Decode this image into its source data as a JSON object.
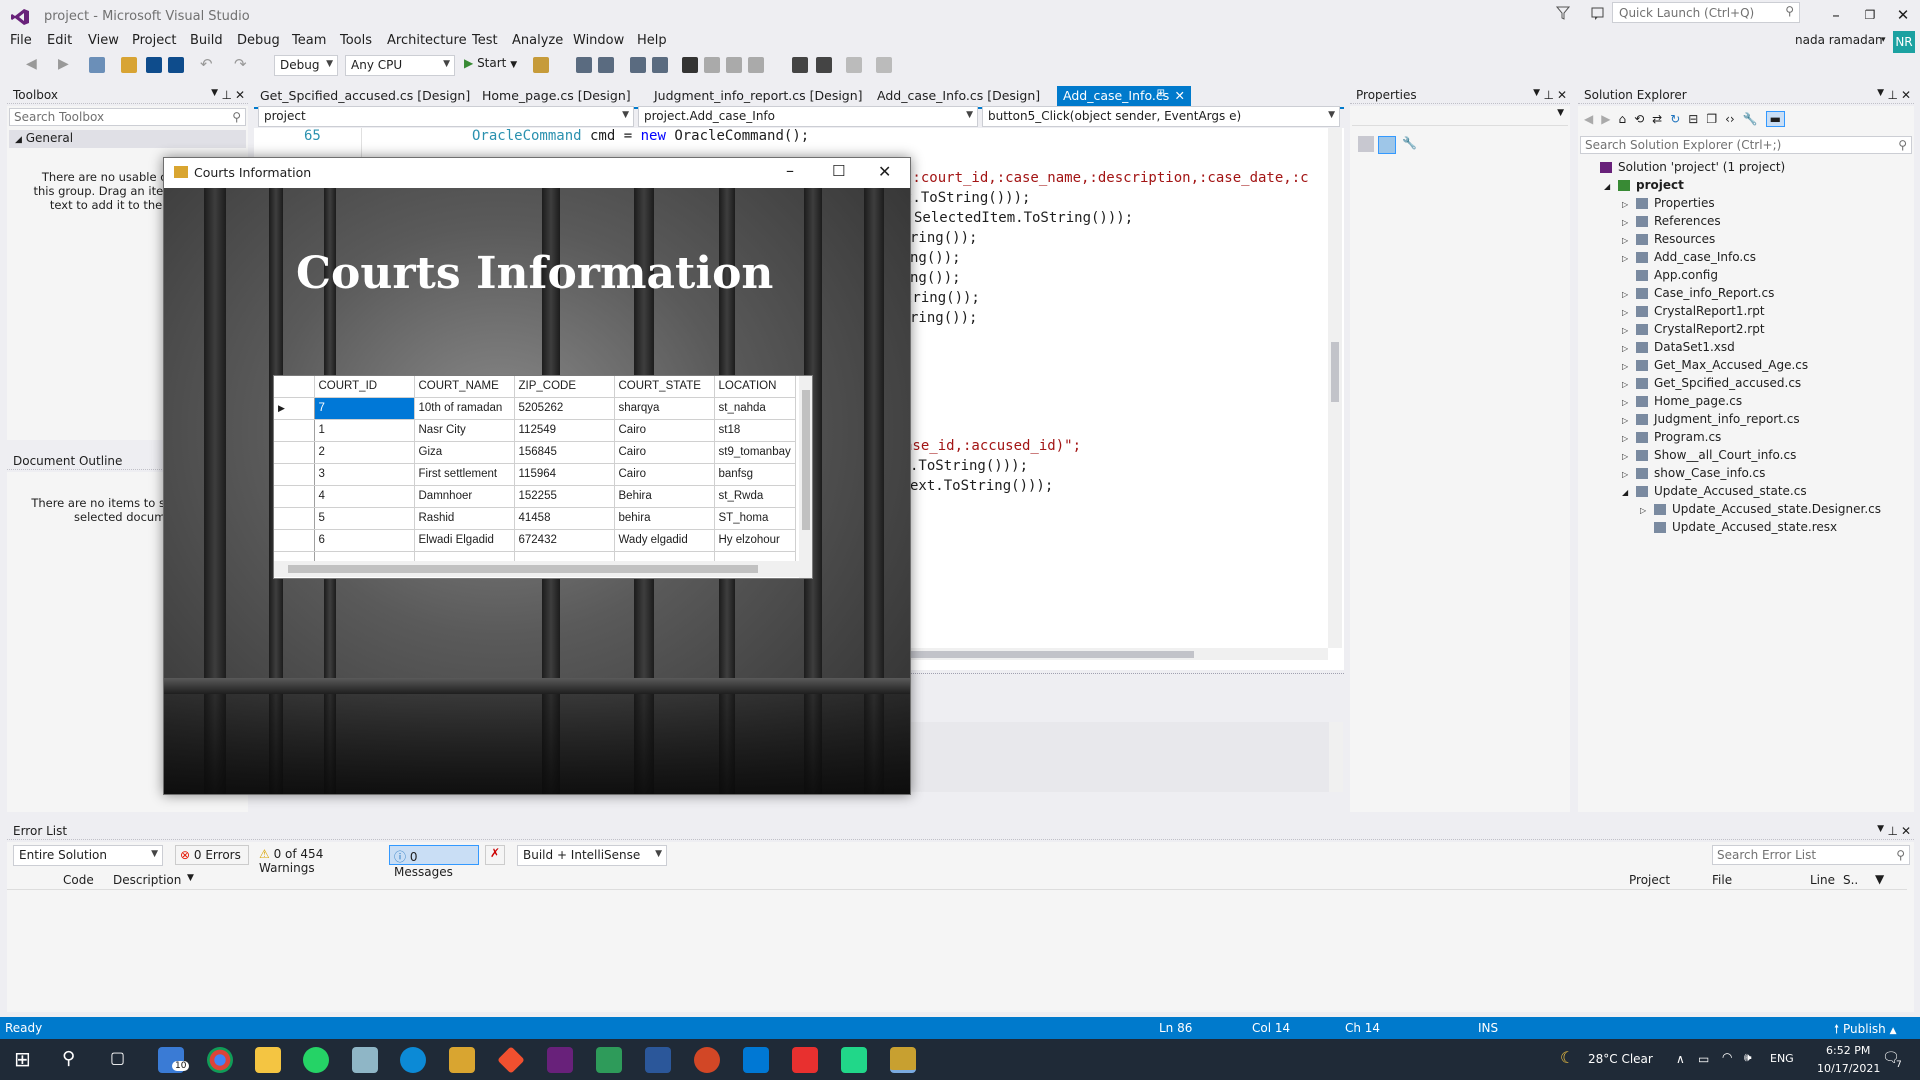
{
  "window": {
    "title": "project - Microsoft Visual Studio",
    "quick_launch": "Quick Launch (Ctrl+Q)",
    "user": "nada ramadan",
    "avatar": "NR"
  },
  "menu": [
    "File",
    "Edit",
    "View",
    "Project",
    "Build",
    "Debug",
    "Team",
    "Tools",
    "Architecture",
    "Test",
    "Analyze",
    "Window",
    "Help"
  ],
  "toolbar": {
    "config": "Debug",
    "platform": "Any CPU",
    "start": "Start"
  },
  "toolbox": {
    "title": "Toolbox",
    "search": "Search Toolbox",
    "group": "General",
    "empty": "There are no usable controls in this group. Drag an item onto this text to add it to the toolbox."
  },
  "doc_outline": {
    "title": "Document Outline",
    "empty": "There are no items to show for the selected document."
  },
  "tabs": [
    "Get_Spcified_accused.cs [Design]",
    "Home_page.cs [Design]",
    "Judgment_info_report.cs [Design]",
    "Add_case_Info.cs [Design]",
    "Add_case_Info.cs"
  ],
  "nav": {
    "project": "project",
    "class": "project.Add_case_Info",
    "member": "button5_Click(object sender, EventArgs e)"
  },
  "code": {
    "line_no": "65",
    "line65_kw": "OracleCommand",
    "line65_a": " cmd = ",
    "line65_new": "new",
    "line65_b": " OracleCommand();",
    "l1": ",:court_id,:case_name,:description,:case_date,:c",
    "l2": "t.ToString()));",
    "l3": "SelectedItem.ToString()));",
    "l4": "ring());",
    "l5": "ng());",
    "l6": "ng());",
    "l7": "tring());",
    "l8": "ring());",
    "l9": "ase_id,:accused_id)\";",
    "l10": ".ToString()));",
    "l11": "ext.ToString()));"
  },
  "app": {
    "title": "Courts Information",
    "heading": "Courts Information",
    "columns": [
      "COURT_ID",
      "COURT_NAME",
      "ZIP_CODE",
      "COURT_STATE",
      "LOCATION"
    ],
    "rows": [
      [
        "7",
        "10th of ramadan",
        "5205262",
        "sharqya",
        "st_nahda"
      ],
      [
        "1",
        "Nasr City",
        "112549",
        "Cairo",
        "st18"
      ],
      [
        "2",
        "Giza",
        "156845",
        "Cairo",
        "st9_tomanbay"
      ],
      [
        "3",
        "First settlement",
        "115964",
        "Cairo",
        "banfsg"
      ],
      [
        "4",
        "Damnhoer",
        "152255",
        "Behira",
        "st_Rwda"
      ],
      [
        "5",
        "Rashid",
        "41458",
        "behira",
        "ST_homa"
      ],
      [
        "6",
        "Elwadi Elgadid",
        "672432",
        "Wady elgadid",
        "Hy elzohour"
      ]
    ]
  },
  "properties": {
    "title": "Properties"
  },
  "solution": {
    "title": "Solution Explorer",
    "search": "Search Solution Explorer (Ctrl+;)",
    "items": [
      {
        "label": "Solution 'project' (1 project)",
        "depth": 0,
        "exp": ""
      },
      {
        "label": "project",
        "depth": 1,
        "exp": "◢",
        "bold": true
      },
      {
        "label": "Properties",
        "depth": 2,
        "exp": "▷"
      },
      {
        "label": "References",
        "depth": 2,
        "exp": "▷"
      },
      {
        "label": "Resources",
        "depth": 2,
        "exp": "▷"
      },
      {
        "label": "Add_case_Info.cs",
        "depth": 2,
        "exp": "▷"
      },
      {
        "label": "App.config",
        "depth": 2,
        "exp": ""
      },
      {
        "label": "Case_info_Report.cs",
        "depth": 2,
        "exp": "▷"
      },
      {
        "label": "CrystalReport1.rpt",
        "depth": 2,
        "exp": "▷"
      },
      {
        "label": "CrystalReport2.rpt",
        "depth": 2,
        "exp": "▷"
      },
      {
        "label": "DataSet1.xsd",
        "depth": 2,
        "exp": "▷"
      },
      {
        "label": "Get_Max_Accused_Age.cs",
        "depth": 2,
        "exp": "▷"
      },
      {
        "label": "Get_Spcified_accused.cs",
        "depth": 2,
        "exp": "▷"
      },
      {
        "label": "Home_page.cs",
        "depth": 2,
        "exp": "▷"
      },
      {
        "label": "Judgment_info_report.cs",
        "depth": 2,
        "exp": "▷"
      },
      {
        "label": "Program.cs",
        "depth": 2,
        "exp": "▷"
      },
      {
        "label": "Show__all_Court_info.cs",
        "depth": 2,
        "exp": "▷"
      },
      {
        "label": "show_Case_info.cs",
        "depth": 2,
        "exp": "▷"
      },
      {
        "label": "Update_Accused_state.cs",
        "depth": 2,
        "exp": "◢"
      },
      {
        "label": "Update_Accused_state.Designer.cs",
        "depth": 3,
        "exp": "▷"
      },
      {
        "label": "Update_Accused_state.resx",
        "depth": 3,
        "exp": ""
      }
    ]
  },
  "errorlist": {
    "title": "Error List",
    "scope": "Entire Solution",
    "errors": "0 Errors",
    "warnings": "0 of 454 Warnings",
    "messages": "0 Messages",
    "build": "Build + IntelliSense",
    "search": "Search Error List",
    "col_code": "Code",
    "col_desc": "Description",
    "col_project": "Project",
    "col_file": "File",
    "col_line": "Line",
    "col_s": "S.."
  },
  "status": {
    "ready": "Ready",
    "ln": "Ln 86",
    "col": "Col 14",
    "ch": "Ch 14",
    "ins": "INS",
    "publish": "Publish"
  },
  "taskbar": {
    "weather": "28°C  Clear",
    "lang": "ENG",
    "time": "6:52 PM",
    "date": "10/17/2021",
    "mail_badge": "10",
    "notif": "7"
  }
}
